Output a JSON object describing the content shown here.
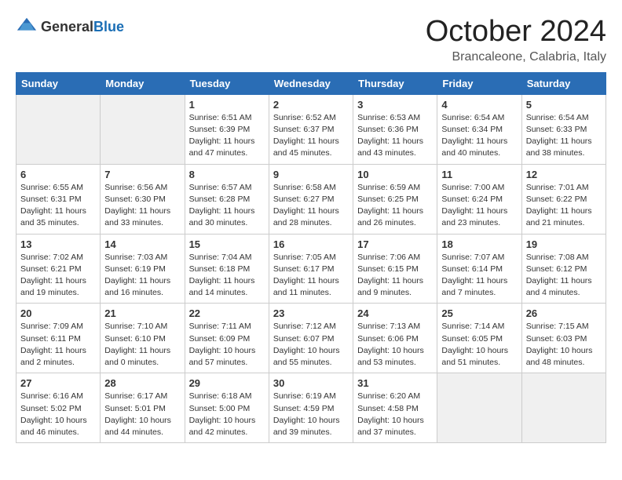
{
  "logo": {
    "general": "General",
    "blue": "Blue"
  },
  "title": "October 2024",
  "location": "Brancaleone, Calabria, Italy",
  "days_of_week": [
    "Sunday",
    "Monday",
    "Tuesday",
    "Wednesday",
    "Thursday",
    "Friday",
    "Saturday"
  ],
  "weeks": [
    [
      {
        "day": "",
        "empty": true
      },
      {
        "day": "",
        "empty": true
      },
      {
        "day": "1",
        "sunrise": "Sunrise: 6:51 AM",
        "sunset": "Sunset: 6:39 PM",
        "daylight": "Daylight: 11 hours and 47 minutes."
      },
      {
        "day": "2",
        "sunrise": "Sunrise: 6:52 AM",
        "sunset": "Sunset: 6:37 PM",
        "daylight": "Daylight: 11 hours and 45 minutes."
      },
      {
        "day": "3",
        "sunrise": "Sunrise: 6:53 AM",
        "sunset": "Sunset: 6:36 PM",
        "daylight": "Daylight: 11 hours and 43 minutes."
      },
      {
        "day": "4",
        "sunrise": "Sunrise: 6:54 AM",
        "sunset": "Sunset: 6:34 PM",
        "daylight": "Daylight: 11 hours and 40 minutes."
      },
      {
        "day": "5",
        "sunrise": "Sunrise: 6:54 AM",
        "sunset": "Sunset: 6:33 PM",
        "daylight": "Daylight: 11 hours and 38 minutes."
      }
    ],
    [
      {
        "day": "6",
        "sunrise": "Sunrise: 6:55 AM",
        "sunset": "Sunset: 6:31 PM",
        "daylight": "Daylight: 11 hours and 35 minutes."
      },
      {
        "day": "7",
        "sunrise": "Sunrise: 6:56 AM",
        "sunset": "Sunset: 6:30 PM",
        "daylight": "Daylight: 11 hours and 33 minutes."
      },
      {
        "day": "8",
        "sunrise": "Sunrise: 6:57 AM",
        "sunset": "Sunset: 6:28 PM",
        "daylight": "Daylight: 11 hours and 30 minutes."
      },
      {
        "day": "9",
        "sunrise": "Sunrise: 6:58 AM",
        "sunset": "Sunset: 6:27 PM",
        "daylight": "Daylight: 11 hours and 28 minutes."
      },
      {
        "day": "10",
        "sunrise": "Sunrise: 6:59 AM",
        "sunset": "Sunset: 6:25 PM",
        "daylight": "Daylight: 11 hours and 26 minutes."
      },
      {
        "day": "11",
        "sunrise": "Sunrise: 7:00 AM",
        "sunset": "Sunset: 6:24 PM",
        "daylight": "Daylight: 11 hours and 23 minutes."
      },
      {
        "day": "12",
        "sunrise": "Sunrise: 7:01 AM",
        "sunset": "Sunset: 6:22 PM",
        "daylight": "Daylight: 11 hours and 21 minutes."
      }
    ],
    [
      {
        "day": "13",
        "sunrise": "Sunrise: 7:02 AM",
        "sunset": "Sunset: 6:21 PM",
        "daylight": "Daylight: 11 hours and 19 minutes."
      },
      {
        "day": "14",
        "sunrise": "Sunrise: 7:03 AM",
        "sunset": "Sunset: 6:19 PM",
        "daylight": "Daylight: 11 hours and 16 minutes."
      },
      {
        "day": "15",
        "sunrise": "Sunrise: 7:04 AM",
        "sunset": "Sunset: 6:18 PM",
        "daylight": "Daylight: 11 hours and 14 minutes."
      },
      {
        "day": "16",
        "sunrise": "Sunrise: 7:05 AM",
        "sunset": "Sunset: 6:17 PM",
        "daylight": "Daylight: 11 hours and 11 minutes."
      },
      {
        "day": "17",
        "sunrise": "Sunrise: 7:06 AM",
        "sunset": "Sunset: 6:15 PM",
        "daylight": "Daylight: 11 hours and 9 minutes."
      },
      {
        "day": "18",
        "sunrise": "Sunrise: 7:07 AM",
        "sunset": "Sunset: 6:14 PM",
        "daylight": "Daylight: 11 hours and 7 minutes."
      },
      {
        "day": "19",
        "sunrise": "Sunrise: 7:08 AM",
        "sunset": "Sunset: 6:12 PM",
        "daylight": "Daylight: 11 hours and 4 minutes."
      }
    ],
    [
      {
        "day": "20",
        "sunrise": "Sunrise: 7:09 AM",
        "sunset": "Sunset: 6:11 PM",
        "daylight": "Daylight: 11 hours and 2 minutes."
      },
      {
        "day": "21",
        "sunrise": "Sunrise: 7:10 AM",
        "sunset": "Sunset: 6:10 PM",
        "daylight": "Daylight: 11 hours and 0 minutes."
      },
      {
        "day": "22",
        "sunrise": "Sunrise: 7:11 AM",
        "sunset": "Sunset: 6:09 PM",
        "daylight": "Daylight: 10 hours and 57 minutes."
      },
      {
        "day": "23",
        "sunrise": "Sunrise: 7:12 AM",
        "sunset": "Sunset: 6:07 PM",
        "daylight": "Daylight: 10 hours and 55 minutes."
      },
      {
        "day": "24",
        "sunrise": "Sunrise: 7:13 AM",
        "sunset": "Sunset: 6:06 PM",
        "daylight": "Daylight: 10 hours and 53 minutes."
      },
      {
        "day": "25",
        "sunrise": "Sunrise: 7:14 AM",
        "sunset": "Sunset: 6:05 PM",
        "daylight": "Daylight: 10 hours and 51 minutes."
      },
      {
        "day": "26",
        "sunrise": "Sunrise: 7:15 AM",
        "sunset": "Sunset: 6:03 PM",
        "daylight": "Daylight: 10 hours and 48 minutes."
      }
    ],
    [
      {
        "day": "27",
        "sunrise": "Sunrise: 6:16 AM",
        "sunset": "Sunset: 5:02 PM",
        "daylight": "Daylight: 10 hours and 46 minutes."
      },
      {
        "day": "28",
        "sunrise": "Sunrise: 6:17 AM",
        "sunset": "Sunset: 5:01 PM",
        "daylight": "Daylight: 10 hours and 44 minutes."
      },
      {
        "day": "29",
        "sunrise": "Sunrise: 6:18 AM",
        "sunset": "Sunset: 5:00 PM",
        "daylight": "Daylight: 10 hours and 42 minutes."
      },
      {
        "day": "30",
        "sunrise": "Sunrise: 6:19 AM",
        "sunset": "Sunset: 4:59 PM",
        "daylight": "Daylight: 10 hours and 39 minutes."
      },
      {
        "day": "31",
        "sunrise": "Sunrise: 6:20 AM",
        "sunset": "Sunset: 4:58 PM",
        "daylight": "Daylight: 10 hours and 37 minutes."
      },
      {
        "day": "",
        "empty": true
      },
      {
        "day": "",
        "empty": true
      }
    ]
  ]
}
